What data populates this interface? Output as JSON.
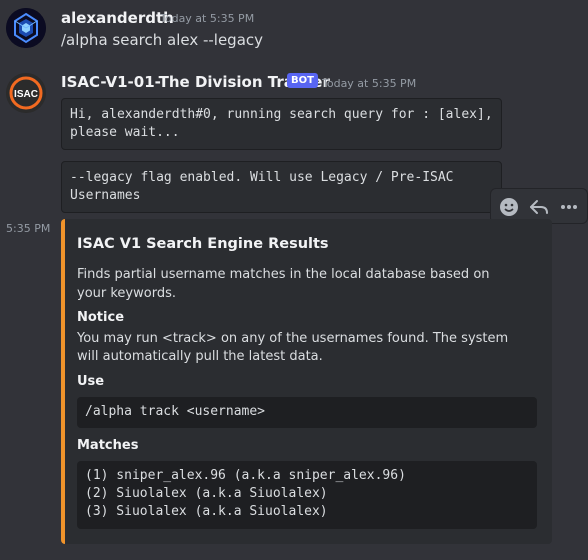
{
  "user_message": {
    "username": "alexanderdth",
    "timestamp": "Today at 5:35 PM",
    "content": "/alpha search alex --legacy"
  },
  "bot_message": {
    "username": "ISAC-V1-01-The Division Tracker",
    "badge": "BOT",
    "timestamp": "Today at 5:35 PM",
    "avatar_text": "ISAC",
    "code_block_1": "Hi, alexanderdth#0, running search query for : [alex],\nplease wait...",
    "code_block_2": "--legacy flag enabled. Will use Legacy / Pre-ISAC\nUsernames"
  },
  "second_message": {
    "side_timestamp": "5:35 PM"
  },
  "embed": {
    "accent_color": "#f0932b",
    "title": "ISAC V1 Search Engine Results",
    "description": "Finds partial username matches in the local database based on your keywords.",
    "fields": {
      "notice": {
        "name": "Notice",
        "value": "You may run <track> on any of the usernames found. The system will automatically pull the latest data."
      },
      "use": {
        "name": "Use",
        "value": "/alpha track <username>"
      },
      "matches": {
        "name": "Matches",
        "value": "(1) sniper_alex.96 (a.k.a sniper_alex.96)\n(2) Siuolalex (a.k.a Siuolalex)\n(3) Siuolalex (a.k.a Siuolalex)"
      }
    }
  },
  "hover_toolbar": {
    "icons": [
      "add-reaction-icon",
      "reply-icon",
      "more-options-icon"
    ]
  }
}
